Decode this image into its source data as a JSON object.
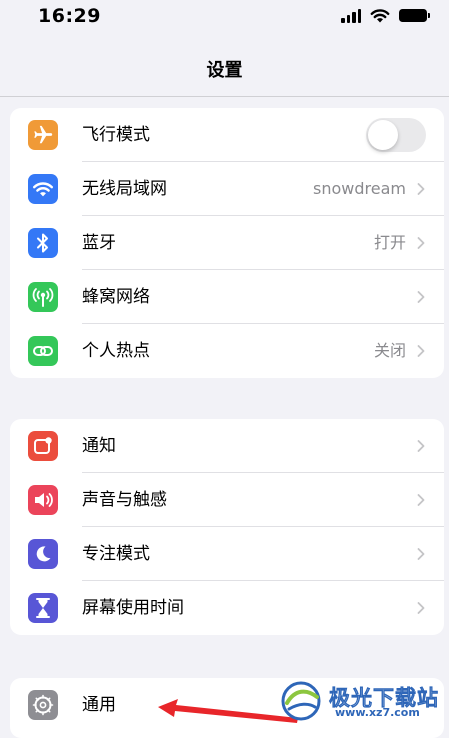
{
  "status_bar": {
    "time": "16:29"
  },
  "nav": {
    "title": "设置"
  },
  "groups": [
    {
      "items": [
        {
          "label": "飞行模式",
          "icon": "airplane-icon",
          "icon_color": "#f09a37",
          "control": "toggle",
          "toggle_on": false
        },
        {
          "label": "无线局域网",
          "icon": "wifi-icon",
          "icon_color": "#3478f6",
          "value": "snowdream"
        },
        {
          "label": "蓝牙",
          "icon": "bluetooth-icon",
          "icon_color": "#3478f6",
          "value": "打开"
        },
        {
          "label": "蜂窝网络",
          "icon": "cellular-icon",
          "icon_color": "#34c759",
          "value": ""
        },
        {
          "label": "个人热点",
          "icon": "hotspot-icon",
          "icon_color": "#34c759",
          "value": "关闭"
        }
      ]
    },
    {
      "items": [
        {
          "label": "通知",
          "icon": "notifications-icon",
          "icon_color": "#eb4d3d"
        },
        {
          "label": "声音与触感",
          "icon": "sound-icon",
          "icon_color": "#eb445a"
        },
        {
          "label": "专注模式",
          "icon": "focus-moon-icon",
          "icon_color": "#5856d6"
        },
        {
          "label": "屏幕使用时间",
          "icon": "hourglass-icon",
          "icon_color": "#5856d6"
        }
      ]
    },
    {
      "items": [
        {
          "label": "通用",
          "icon": "gear-icon",
          "icon_color": "#8e8e93"
        }
      ]
    }
  ],
  "watermark": {
    "title": "极光下载站",
    "url": "www.xz7.com"
  }
}
